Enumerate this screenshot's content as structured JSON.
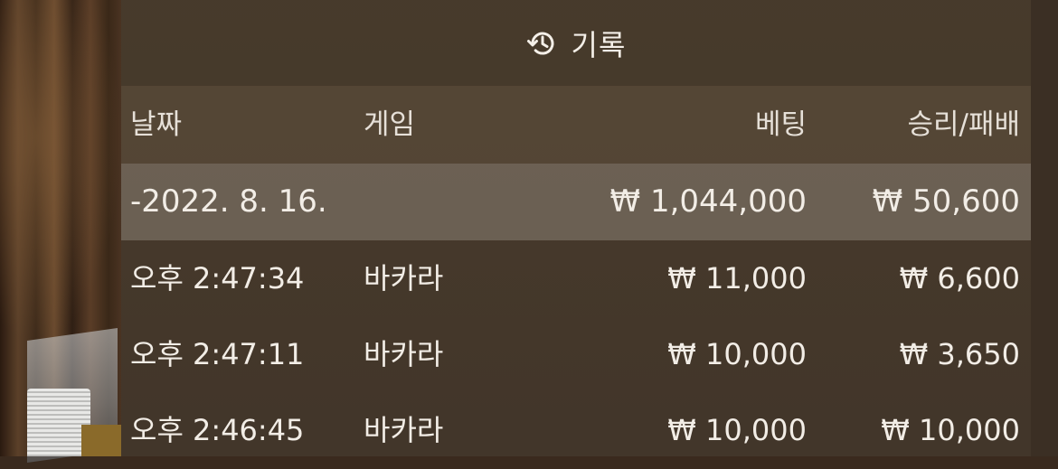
{
  "header": {
    "title": "기록",
    "icon": "history-icon"
  },
  "columns": {
    "date": "날짜",
    "game": "게임",
    "bet": "베팅",
    "result": "승리/패배"
  },
  "summary": {
    "date": "-2022. 8. 16.",
    "bet": "₩ 1,044,000",
    "result": "₩ 50,600"
  },
  "rows": [
    {
      "time": "오후 2:47:34",
      "game": "바카라",
      "bet": "₩ 11,000",
      "result": "₩ 6,600"
    },
    {
      "time": "오후 2:47:11",
      "game": "바카라",
      "bet": "₩ 10,000",
      "result": "₩ 3,650"
    },
    {
      "time": "오후 2:46:45",
      "game": "바카라",
      "bet": "₩ 10,000",
      "result": "₩ 10,000"
    }
  ]
}
